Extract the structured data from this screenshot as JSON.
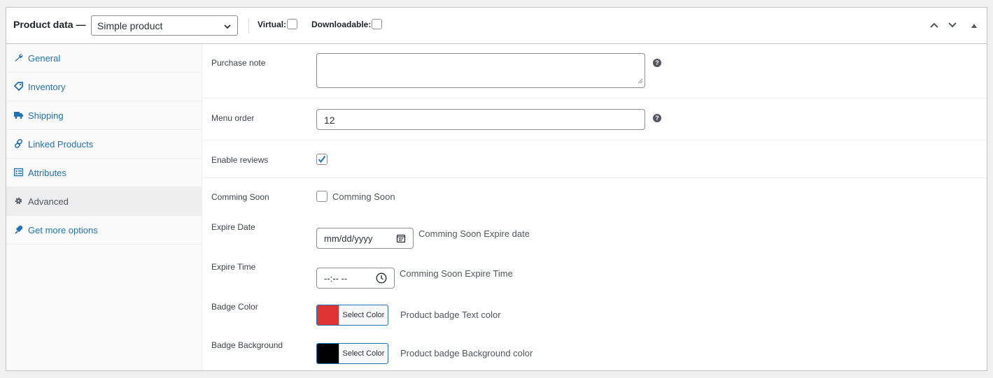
{
  "header": {
    "title": "Product data —",
    "product_type": "Simple product",
    "virtual_label": "Virtual:",
    "downloadable_label": "Downloadable:"
  },
  "sidebar": {
    "items": [
      {
        "label": "General",
        "icon": "wrench-icon",
        "active": false
      },
      {
        "label": "Inventory",
        "icon": "tag-icon",
        "active": false
      },
      {
        "label": "Shipping",
        "icon": "truck-icon",
        "active": false
      },
      {
        "label": "Linked Products",
        "icon": "link-icon",
        "active": false
      },
      {
        "label": "Attributes",
        "icon": "list-icon",
        "active": false
      },
      {
        "label": "Advanced",
        "icon": "gear-icon",
        "active": true
      },
      {
        "label": "Get more options",
        "icon": "plugin-icon",
        "active": false
      }
    ]
  },
  "fields": {
    "purchase_note": {
      "label": "Purchase note",
      "value": ""
    },
    "menu_order": {
      "label": "Menu order",
      "value": "12"
    },
    "enable_reviews": {
      "label": "Enable reviews",
      "checked": true
    },
    "coming_soon": {
      "label": "Comming Soon",
      "checkbox_label": "Comming Soon",
      "checked": false
    },
    "expire_date": {
      "label": "Expire Date",
      "placeholder": "mm/dd/yyyy",
      "description": "Comming Soon Expire date"
    },
    "expire_time": {
      "label": "Expire Time",
      "placeholder": "--:-- --",
      "description": "Comming Soon Expire Time"
    },
    "badge_color": {
      "label": "Badge Color",
      "button_label": "Select Color",
      "color": "#dd3333",
      "description": "Product badge Text color"
    },
    "badge_background": {
      "label": "Badge Background",
      "button_label": "Select Color",
      "color": "#000000",
      "description": "Product badge Background color"
    }
  },
  "colors": {
    "link": "#2271b1",
    "checkmark": "#2271b1"
  }
}
